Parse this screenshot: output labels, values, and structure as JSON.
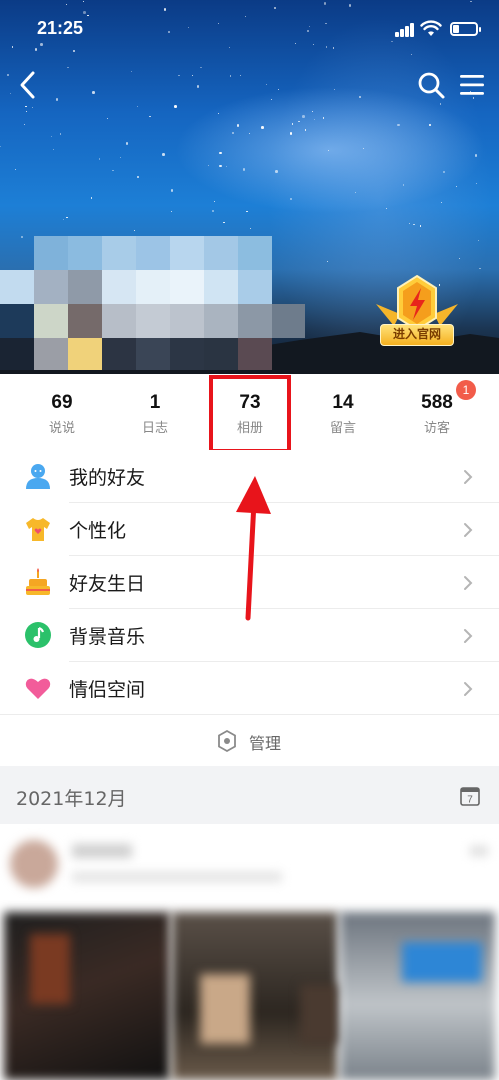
{
  "status_bar": {
    "time": "21:25"
  },
  "header": {
    "back_icon": "chevron-left-icon",
    "search_icon": "search-icon",
    "menu_icon": "hamburger-menu-icon",
    "badge_label": "进入官网"
  },
  "stats": [
    {
      "value": "69",
      "label": "说说"
    },
    {
      "value": "1",
      "label": "日志"
    },
    {
      "value": "73",
      "label": "相册"
    },
    {
      "value": "14",
      "label": "留言"
    },
    {
      "value": "588",
      "label": "访客"
    }
  ],
  "visitor_badge": "1",
  "menu": {
    "items": [
      {
        "label": "我的好友",
        "icon": "friends-icon"
      },
      {
        "label": "个性化",
        "icon": "tshirt-icon"
      },
      {
        "label": "好友生日",
        "icon": "birthday-cake-icon"
      },
      {
        "label": "背景音乐",
        "icon": "music-note-icon"
      },
      {
        "label": "情侣空间",
        "icon": "heart-icon"
      }
    ],
    "manage_label": "管理"
  },
  "feed": {
    "date_label": "2021年12月",
    "calendar_icon": "calendar-icon",
    "calendar_day": "7"
  },
  "colors": {
    "highlight": "#e8141b",
    "notification": "#f25c4a",
    "friends": "#4aa8f0",
    "music": "#2bc16a",
    "heart": "#f25c9a"
  }
}
